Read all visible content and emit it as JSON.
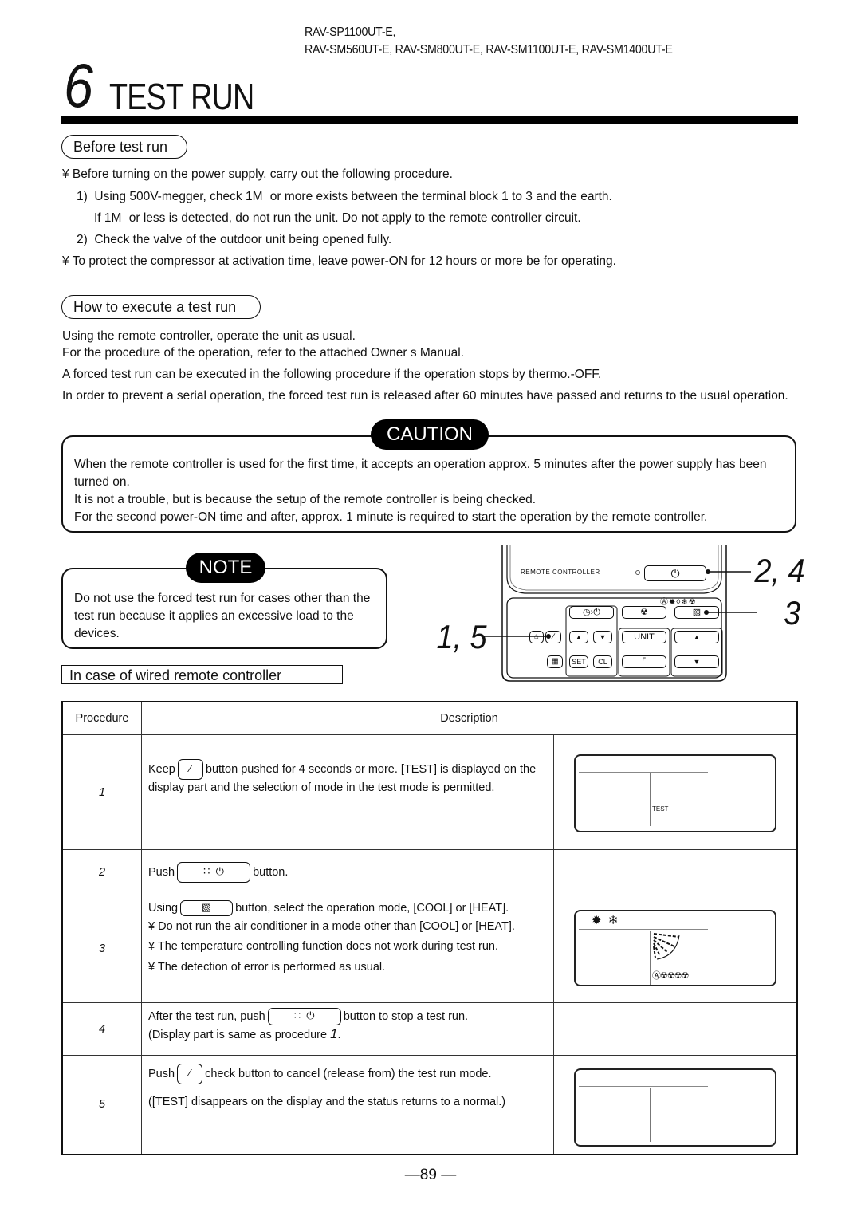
{
  "header": {
    "models_line1": "RAV-SP1100UT-E,",
    "models_line2": "RAV-SM560UT-E, RAV-SM800UT-E, RAV-SM1100UT-E, RAV-SM1400UT-E",
    "chapter_number": "6",
    "chapter_title": "TEST RUN"
  },
  "before_test_run": {
    "heading": "Before test run",
    "items": [
      "¥ Before turning on the power supply, carry out the following procedure.",
      "1)  Using 500V-megger, check 1M   or more exists between the terminal block 1 to 3 and the earth.",
      "If 1M   or less is detected, do not run the unit.  Do not apply to the remote controller circuit.",
      "2)  Check the valve of the outdoor unit being opened fully.",
      "¥ To protect the compressor at activation time, leave power-ON for 12 hours or more be for operating."
    ]
  },
  "how_to_execute": {
    "heading": "How to execute a test run",
    "paragraphs": [
      "Using the remote controller, operate the unit as usual.",
      "For the procedure of the operation, refer to the attached Owner s Manual.",
      "A forced test run can be executed in the following procedure if the operation stops by thermo.-OFF.",
      "In order to prevent a serial operation, the forced test run is released after 60 minutes have passed and returns to the usual operation."
    ]
  },
  "caution": {
    "label": "CAUTION",
    "lines": [
      "When the remote controller is used for the first time, it accepts an operation approx. 5 minutes after the power supply has been turned on.",
      "It is not a trouble, but is because the setup of the remote controller is being checked.",
      "For the second power-ON time and after, approx. 1 minute is required to start the operation by the remote controller."
    ]
  },
  "note": {
    "label": "NOTE",
    "text": "Do not use the forced test run for cases other than the test run because it applies an excessive load to the devices."
  },
  "wired_heading": "In case of wired remote controller",
  "remote": {
    "label": "REMOTE CONTROLLER",
    "callout_power": "2, 4",
    "callout_mode": "3",
    "callout_check": "1, 5",
    "btn_unit": "UNIT",
    "btn_set": "SET",
    "btn_cl": "CL",
    "mode_icons": "Ⓐ✹◊❄☢"
  },
  "table": {
    "col_procedure": "Procedure",
    "col_description": "Description",
    "rows": [
      {
        "step": "1",
        "pre": "Keep",
        "post": "button pushed for 4 seconds or more.  [TEST] is displayed on the display part and the selection of mode in the test mode is permitted.",
        "lcd_text": "TEST"
      },
      {
        "step": "2",
        "pre": "Push",
        "post": "button."
      },
      {
        "step": "3",
        "pre": "Using",
        "post": "button, select the operation mode, [COOL] or [HEAT].",
        "bullets": [
          "¥ Do not run the air conditioner in a mode other than [COOL] or [HEAT].",
          "¥ The temperature controlling function does not work during test run.",
          "¥ The detection of error is performed as usual."
        ],
        "lcd_icons": "✹  ❄",
        "lcd_fan": "Ⓐ☢☢☢☢"
      },
      {
        "step": "4",
        "pre": "After the test run, push",
        "post": "button to stop a test run.",
        "line2": "(Display part is same as procedure",
        "line2_ref": "1",
        "line2_end": "."
      },
      {
        "step": "5",
        "pre": "Push",
        "post": "check button to cancel (release from) the test run mode.",
        "line2": "([TEST] disappears on the display and the status returns to a normal.)"
      }
    ]
  },
  "page_number": "89"
}
